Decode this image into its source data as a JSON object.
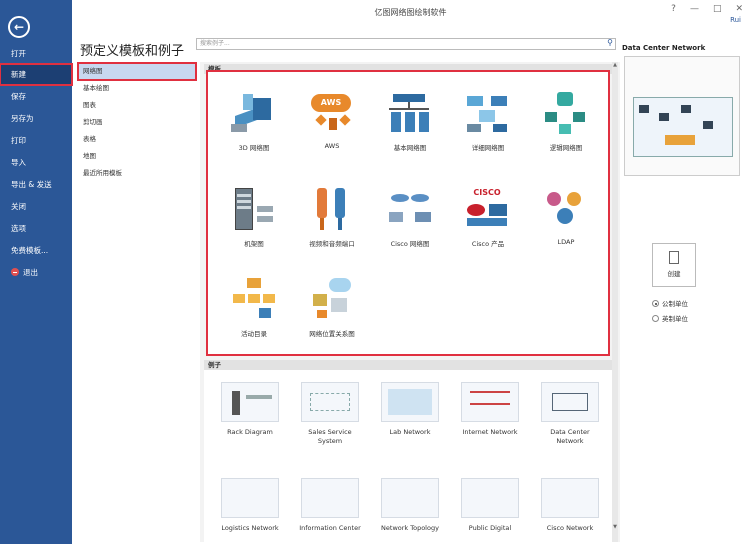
{
  "window": {
    "title": "亿图网络图绘制软件",
    "user": "Rui",
    "controls": [
      "?",
      "—",
      "□",
      "✕"
    ]
  },
  "sidebar": {
    "back_icon": "back-arrow-icon",
    "items": [
      {
        "label": "打开",
        "active": false
      },
      {
        "label": "新建",
        "active": true
      },
      {
        "label": "保存",
        "active": false
      },
      {
        "label": "另存为",
        "active": false
      },
      {
        "label": "打印",
        "active": false
      },
      {
        "label": "导入",
        "active": false
      },
      {
        "label": "导出 & 发送",
        "active": false
      },
      {
        "label": "关闭",
        "active": false
      },
      {
        "label": "选项",
        "active": false
      },
      {
        "label": "免费模板...",
        "active": false
      },
      {
        "label": "退出",
        "active": false
      }
    ]
  },
  "heading": "预定义模板和例子",
  "search": {
    "placeholder": "搜索例子..."
  },
  "categories": [
    "网络图",
    "基本绘图",
    "图表",
    "剪切画",
    "表格",
    "地图",
    "最近所用模板"
  ],
  "templates_section": "模板",
  "templates": [
    {
      "label": "3D 网络图",
      "icon": "3d-network-icon"
    },
    {
      "label": "AWS",
      "icon": "aws-icon"
    },
    {
      "label": "基本网络图",
      "icon": "basic-network-icon"
    },
    {
      "label": "详细网络图",
      "icon": "detailed-network-icon"
    },
    {
      "label": "逻辑网络图",
      "icon": "logical-network-icon"
    },
    {
      "label": "机架图",
      "icon": "rack-icon"
    },
    {
      "label": "视频和音频端口",
      "icon": "av-ports-icon"
    },
    {
      "label": "Cisco 网络图",
      "icon": "cisco-network-icon"
    },
    {
      "label": "Cisco 产品",
      "icon": "cisco-products-icon"
    },
    {
      "label": "LDAP",
      "icon": "ldap-icon"
    },
    {
      "label": "活动目录",
      "icon": "active-directory-icon"
    },
    {
      "label": "网络位置关系图",
      "icon": "network-location-icon"
    }
  ],
  "examples_section": "例子",
  "examples": [
    {
      "label": "Rack Diagram"
    },
    {
      "label": "Sales Service System"
    },
    {
      "label": "Lab Network"
    },
    {
      "label": "Internet Network"
    },
    {
      "label": "Data Center\nNetwork"
    },
    {
      "label": "Logistics Network"
    },
    {
      "label": "Information Center"
    },
    {
      "label": "Network Topology"
    },
    {
      "label": "Public Digital"
    },
    {
      "label": "Cisco Network"
    }
  ],
  "preview": {
    "title": "Data Center Network"
  },
  "create": {
    "label": "创建"
  },
  "units": [
    {
      "label": "公制单位",
      "selected": true
    },
    {
      "label": "英制单位",
      "selected": false
    }
  ],
  "colors": {
    "sidebar": "#2b5797",
    "highlight": "#e03040",
    "accent": "#2b579a"
  }
}
